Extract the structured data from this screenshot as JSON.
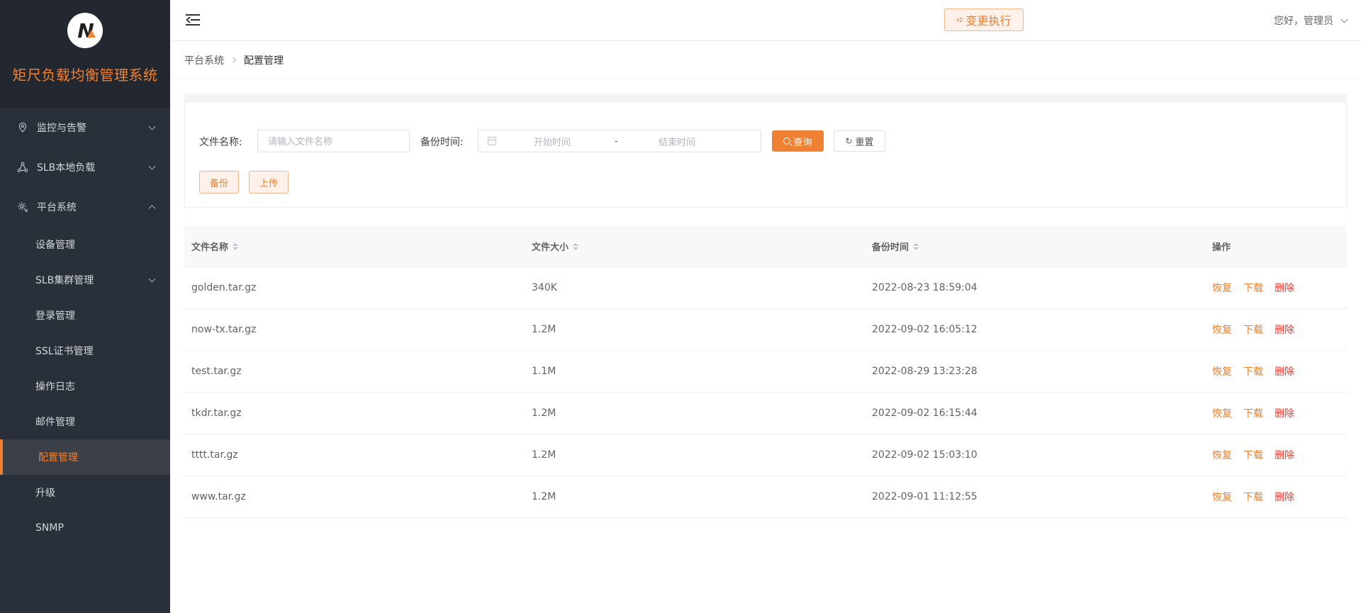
{
  "app": {
    "title": "矩尺负载均衡管理系统"
  },
  "header": {
    "exec_label": "变更执行",
    "user_label": "您好，管理员"
  },
  "sidebar": {
    "groups": [
      {
        "label": "监控与告警",
        "icon": "location-icon"
      },
      {
        "label": "SLB本地负载",
        "icon": "nodes-icon"
      },
      {
        "label": "平台系统",
        "icon": "gear-icon"
      }
    ],
    "sub_items": [
      {
        "label": "设备管理"
      },
      {
        "label": "SLB集群管理"
      },
      {
        "label": "登录管理"
      },
      {
        "label": "SSL证书管理"
      },
      {
        "label": "操作日志"
      },
      {
        "label": "邮件管理"
      },
      {
        "label": "配置管理",
        "active": true
      },
      {
        "label": "升级"
      },
      {
        "label": "SNMP"
      }
    ]
  },
  "breadcrumb": {
    "items": [
      "平台系统",
      "配置管理"
    ]
  },
  "search": {
    "file_name_label": "文件名称:",
    "file_name_placeholder": "请输入文件名称",
    "backup_time_label": "备份时间:",
    "start_placeholder": "开始时间",
    "range_separator": "-",
    "end_placeholder": "结束时间",
    "query_label": "查询",
    "reset_label": "重置",
    "backup_label": "备份",
    "upload_label": "上传"
  },
  "table": {
    "columns": [
      "文件名称",
      "文件大小",
      "备份时间",
      "操作"
    ],
    "actions": {
      "restore": "恢复",
      "download": "下载",
      "delete": "删除"
    },
    "rows": [
      {
        "name": "golden.tar.gz",
        "size": "340K",
        "time": "2022-08-23 18:59:04"
      },
      {
        "name": "now-tx.tar.gz",
        "size": "1.2M",
        "time": "2022-09-02 16:05:12"
      },
      {
        "name": "test.tar.gz",
        "size": "1.1M",
        "time": "2022-08-29 13:23:28"
      },
      {
        "name": "tkdr.tar.gz",
        "size": "1.2M",
        "time": "2022-09-02 16:15:44"
      },
      {
        "name": "tttt.tar.gz",
        "size": "1.2M",
        "time": "2022-09-02 15:03:10"
      },
      {
        "name": "www.tar.gz",
        "size": "1.2M",
        "time": "2022-09-01 11:12:55"
      }
    ]
  },
  "colors": {
    "accent": "#ee8133",
    "sidebar_bg": "#2a3039",
    "brand_bg": "#232830",
    "danger": "#f1362b"
  }
}
